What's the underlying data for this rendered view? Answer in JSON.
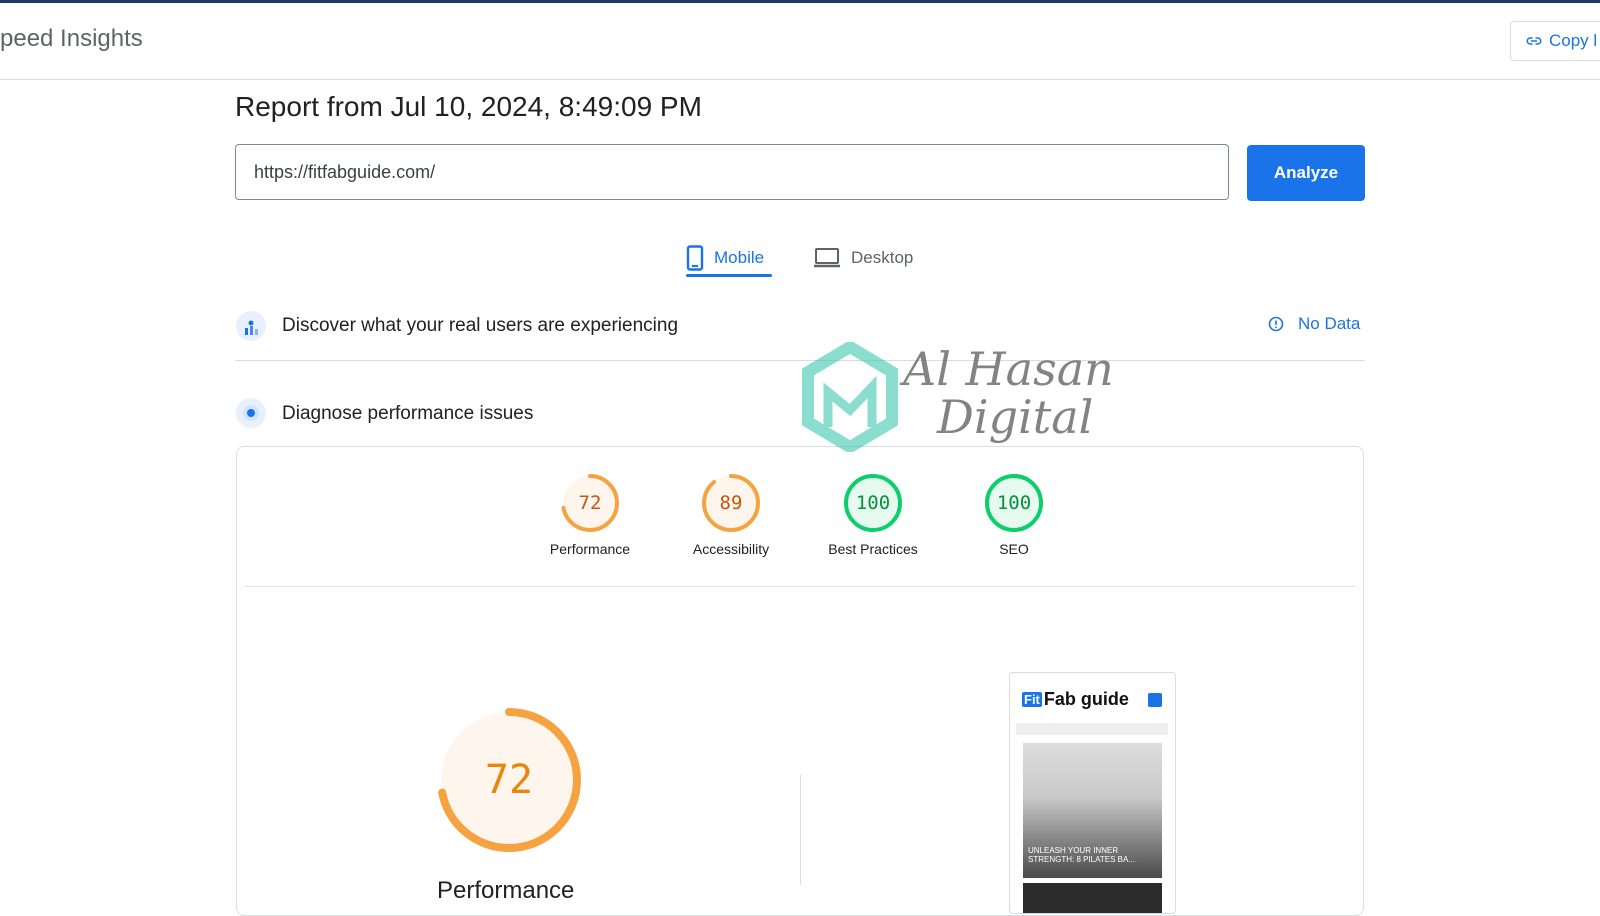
{
  "header": {
    "app_title": "peed Insights",
    "copy_label": "Copy l"
  },
  "report": {
    "title": "Report from Jul 10, 2024, 8:49:09 PM"
  },
  "search": {
    "url": "https://fitfabguide.com/",
    "analyze_label": "Analyze"
  },
  "tabs": [
    {
      "label": "Mobile",
      "icon": "phone-icon",
      "active": true
    },
    {
      "label": "Desktop",
      "icon": "laptop-icon",
      "active": false
    }
  ],
  "field_data": {
    "text": "Discover what your real users are experiencing",
    "status": "No Data",
    "icon": "users-chart-icon",
    "status_icon": "info-icon"
  },
  "diagnose": {
    "text": "Diagnose performance issues",
    "icon": "target-icon"
  },
  "scores": [
    {
      "label": "Performance",
      "value": "72",
      "color": "#f4a340",
      "text_color": "#c5560f",
      "fraction": 0.72
    },
    {
      "label": "Accessibility",
      "value": "89",
      "color": "#f4a340",
      "text_color": "#c5560f",
      "fraction": 0.89
    },
    {
      "label": "Best Practices",
      "value": "100",
      "color": "#0cce6b",
      "text_color": "#0a8f3e",
      "fraction": 1.0
    },
    {
      "label": "SEO",
      "value": "100",
      "color": "#0cce6b",
      "text_color": "#0a8f3e",
      "fraction": 1.0
    }
  ],
  "main_score": {
    "value": "72",
    "label": "Performance",
    "fraction": 0.72,
    "color": "#f4a340",
    "text_color": "#e8860e"
  },
  "screenshot": {
    "logo_fit": "Fit",
    "logo_rest": "Fab guide",
    "hero_text": "UNLEASH YOUR INNER STRENGTH: 8 PILATES BA..."
  },
  "watermark": {
    "line1": "Al Hasan",
    "line2": "Digital"
  },
  "colors": {
    "accent": "#1a73e8",
    "average": "#f4a340",
    "pass": "#0cce6b"
  }
}
